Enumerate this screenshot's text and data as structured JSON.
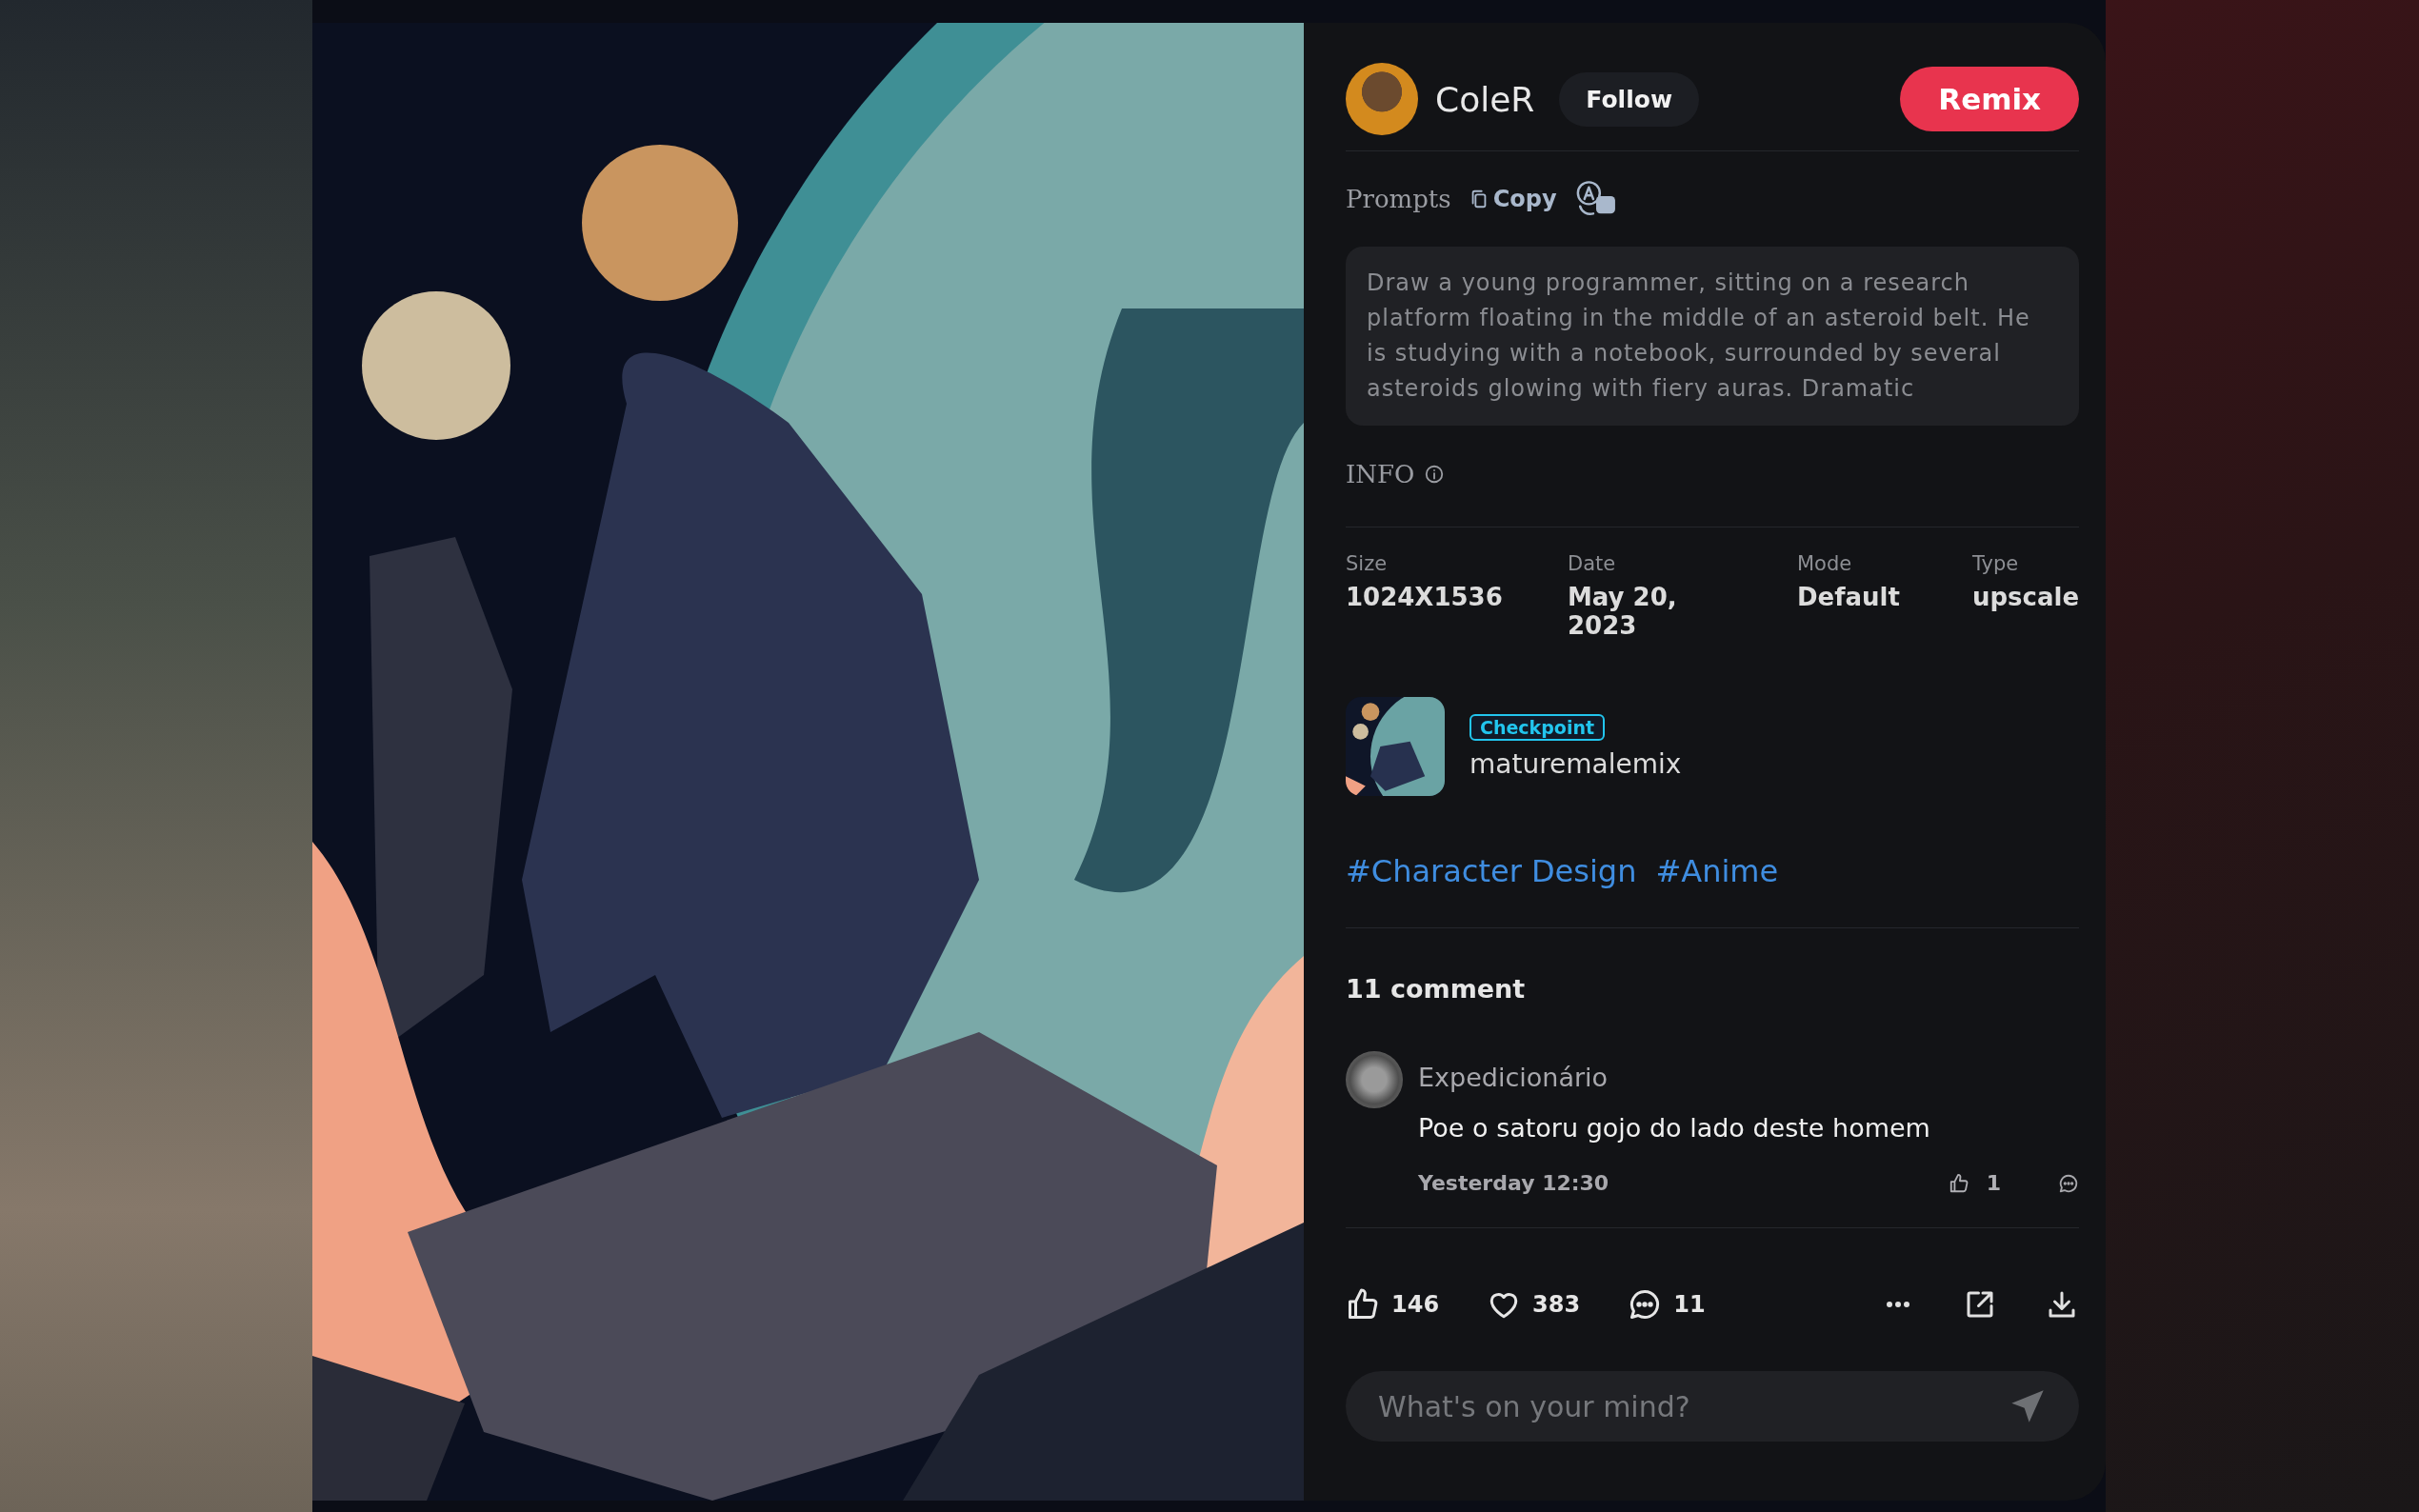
{
  "author": {
    "name": "ColeR",
    "follow_label": "Follow"
  },
  "remix_label": "Remix",
  "prompts": {
    "title": "Prompts",
    "copy_label": "Copy",
    "text": "Draw a young programmer, sitting on a research platform floating in the middle of an asteroid belt. He is studying with a notebook, surrounded by several asteroids glowing with fiery auras. Dramatic"
  },
  "info": {
    "title": "INFO",
    "fields": [
      {
        "label": "Size",
        "value": "1024X1536"
      },
      {
        "label": "Date",
        "value": "May 20, 2023"
      },
      {
        "label": "Mode",
        "value": "Default"
      },
      {
        "label": "Type",
        "value": "upscale"
      }
    ]
  },
  "model": {
    "badge": "Checkpoint",
    "name": "maturemalemix"
  },
  "tags": [
    "#Character Design",
    "#Anime"
  ],
  "comments": {
    "count_label": "11 comment",
    "items": [
      {
        "author": "Expedicionário",
        "text": "Poe o satoru gojo do lado deste homem",
        "time": "Yesterday 12:30",
        "likes": "1"
      }
    ]
  },
  "actions": {
    "likes": "146",
    "favorites": "383",
    "comments": "11"
  },
  "comment_input": {
    "placeholder": "What's on your mind?"
  }
}
